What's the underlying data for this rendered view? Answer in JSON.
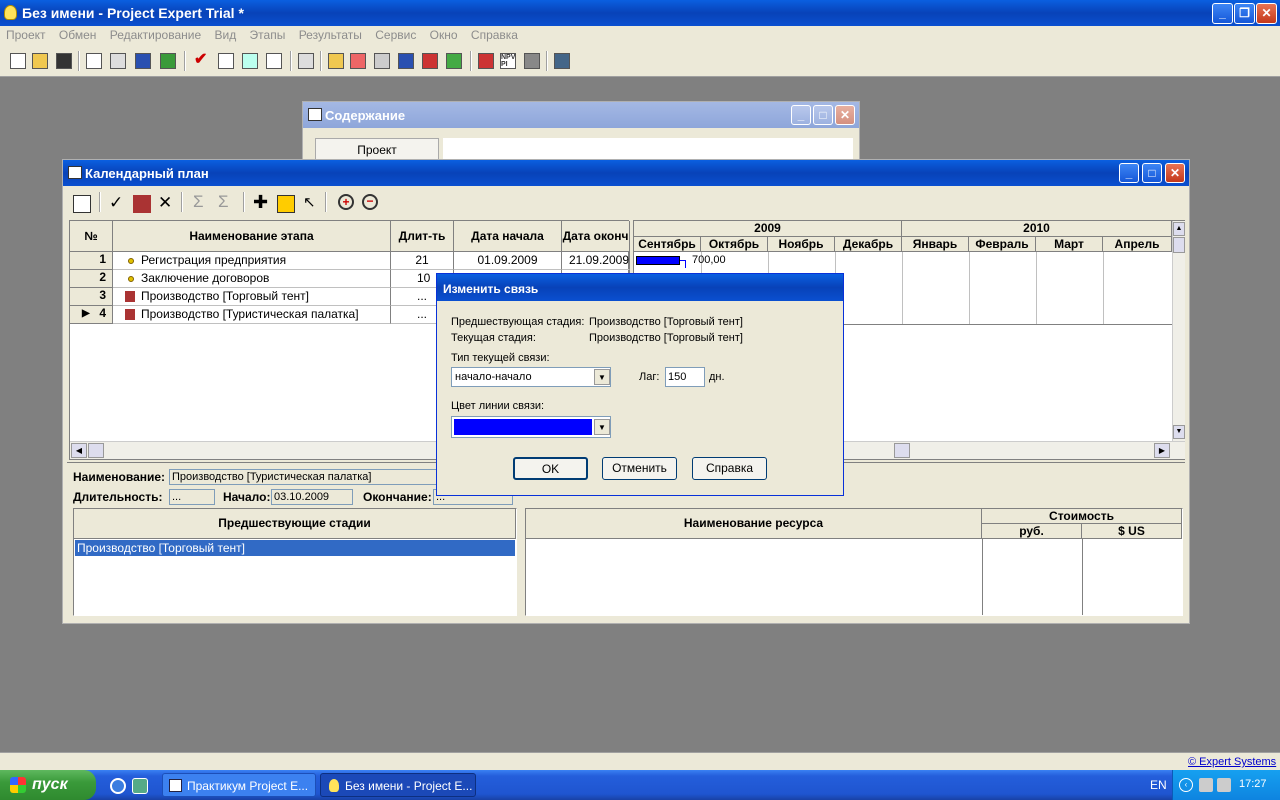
{
  "app": {
    "title": "Без имени - Project Expert Trial *"
  },
  "menu": [
    "Проект",
    "Обмен",
    "Редактирование",
    "Вид",
    "Этапы",
    "Результаты",
    "Сервис",
    "Окно",
    "Справка"
  ],
  "contents_window": {
    "title": "Содержание",
    "tab": "Проект"
  },
  "calendar_window": {
    "title": "Календарный план",
    "columns": {
      "num": "№",
      "name": "Наименование этапа",
      "duration": "Длит-ть",
      "start": "Дата начала",
      "end": "Дата оконч"
    },
    "rows": [
      {
        "num": "1",
        "name": "Регистрация предприятия",
        "duration": "21",
        "start": "01.09.2009",
        "end": "21.09.2009"
      },
      {
        "num": "2",
        "name": "Заключение договоров",
        "duration": "10",
        "start": "",
        "end": ""
      },
      {
        "num": "3",
        "name": "Производство [Торговый тент]",
        "duration": "...",
        "start": "",
        "end": ""
      },
      {
        "num": "4",
        "name": "Производство [Туристическая палатка]",
        "duration": "...",
        "start": "",
        "end": ""
      }
    ],
    "gantt": {
      "years": [
        "2009",
        "2010"
      ],
      "months": [
        "Сентябрь",
        "Октябрь",
        "Ноябрь",
        "Декабрь",
        "Январь",
        "Февраль",
        "Март",
        "Апрель"
      ],
      "bar_label": "700,00"
    },
    "details": {
      "name_label": "Наименование:",
      "name_value": "Производство [Туристическая палатка]",
      "duration_label": "Длительность:",
      "duration_value": "...",
      "start_label": "Начало:",
      "start_value": "03.10.2009",
      "end_label": "Окончание:",
      "end_value": "..."
    },
    "predecessors": {
      "header": "Предшествующие стадии",
      "items": [
        "Производство [Торговый тент]"
      ]
    },
    "resources": {
      "header": "Наименование ресурса",
      "cost_header": "Стоимость",
      "rub": "руб.",
      "usd": "$ US"
    }
  },
  "dialog": {
    "title": "Изменить связь",
    "pred_label": "Предшествующая стадия:",
    "pred_value": "Производство [Торговый тент]",
    "curr_label": "Текущая стадия:",
    "curr_value": "Производство [Торговый тент]",
    "type_label": "Тип текущей связи:",
    "type_value": "начало-начало",
    "lag_label": "Лаг:",
    "lag_value": "150",
    "lag_unit": "дн.",
    "color_label": "Цвет линии связи:",
    "color_value": "#0000ff",
    "ok": "OK",
    "cancel": "Отменить",
    "help": "Справка"
  },
  "statusbar": {
    "copyright": "© Expert Systems"
  },
  "taskbar": {
    "start": "пуск",
    "tasks": [
      "Практикум Project E...",
      "Без имени - Project E..."
    ],
    "lang": "EN",
    "clock": "17:27"
  }
}
